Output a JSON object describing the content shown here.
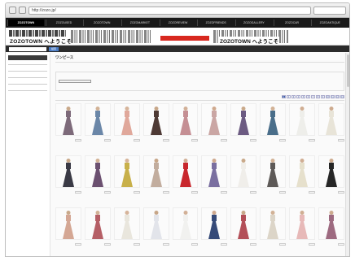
{
  "browser": {
    "address": "http://zozo.jp/",
    "search_placeholder": ""
  },
  "nav": {
    "tabs": [
      {
        "label": "ZOZOTOWN",
        "active": true
      },
      {
        "label": "ZOZOUSED",
        "active": false
      },
      {
        "label": "ZOZOTOWN",
        "active": false
      },
      {
        "label": "ZOZOMARKET",
        "active": false
      },
      {
        "label": "ZOZOREVIEW",
        "active": false
      },
      {
        "label": "ZOZOFRIENDS",
        "active": false
      },
      {
        "label": "ZOZOGALLERY",
        "active": false
      },
      {
        "label": "ZOZOCAR",
        "active": false
      },
      {
        "label": "ZOZOANTIQUE",
        "active": false
      }
    ]
  },
  "banner": {
    "logo_text": "ZOZOTOWN へようこそ",
    "logo_text2": "ZOZOTOWN へようこそ",
    "cta_label": "",
    "user_line1": "",
    "user_line2": "",
    "user_btn": ""
  },
  "searchbar": {
    "search_button": "検索",
    "link": ""
  },
  "sidebar": {
    "header": "",
    "groups": [
      {
        "title": "",
        "links": [
          "",
          "",
          ""
        ]
      },
      {
        "title": "",
        "links": [
          "",
          "",
          "",
          ""
        ]
      },
      {
        "title": "",
        "links": [
          "",
          "",
          "",
          "",
          "",
          "",
          ""
        ]
      },
      {
        "title": "",
        "links": [
          "",
          "",
          ""
        ]
      },
      {
        "title": "",
        "links": [
          "",
          "",
          "",
          ""
        ]
      }
    ]
  },
  "main": {
    "title": "ワンピース",
    "lines": [
      "",
      "",
      "",
      ""
    ],
    "tags": [
      "",
      ""
    ],
    "count_text": "",
    "pager": [
      "1",
      "2",
      "3",
      "4",
      "5",
      "6",
      "7",
      "8",
      "9",
      "10",
      "11",
      "12",
      "13"
    ]
  },
  "colors": {
    "accent": "#3a5ea8",
    "price": "#cc3333",
    "nav_bg": "#1a1a1a"
  },
  "products": [
    {
      "name": "",
      "price": "",
      "dress": "#7d6a7a",
      "skin": "#c9a98a"
    },
    {
      "name": "",
      "price": "",
      "dress": "#6b87a8",
      "skin": "#d2b296"
    },
    {
      "name": "",
      "price": "",
      "dress": "#e0a89b",
      "skin": "#d6b49a"
    },
    {
      "name": "",
      "price": "",
      "dress": "#4e3a35",
      "skin": "#c7a688"
    },
    {
      "name": "",
      "price": "",
      "dress": "#c58f94",
      "skin": "#d2b097"
    },
    {
      "name": "",
      "price": "",
      "dress": "#caa6a4",
      "skin": "#cfa98e"
    },
    {
      "name": "",
      "price": "",
      "dress": "#6c5b82",
      "skin": "#c9a98a"
    },
    {
      "name": "",
      "price": "",
      "dress": "#4a6e8a",
      "skin": "#d2b296"
    },
    {
      "name": "",
      "price": "",
      "dress": "#eeeeea",
      "skin": "#d0ae93"
    },
    {
      "name": "",
      "price": "",
      "dress": "#e8e4d8",
      "skin": "#cdab8f"
    },
    {
      "name": "",
      "price": "",
      "dress": "#3a3a45",
      "skin": "#c9a98a"
    },
    {
      "name": "",
      "price": "",
      "dress": "#6b5070",
      "skin": "#d2b296"
    },
    {
      "name": "",
      "price": "",
      "dress": "#c8b04a",
      "skin": "#d6b49a"
    },
    {
      "name": "",
      "price": "",
      "dress": "#c2ad9e",
      "skin": "#c7a688"
    },
    {
      "name": "",
      "price": "",
      "dress": "#c8272d",
      "skin": "#d2b097"
    },
    {
      "name": "",
      "price": "",
      "dress": "#7a6fa0",
      "skin": "#cfa98e"
    },
    {
      "name": "",
      "price": "",
      "dress": "#f0eeea",
      "skin": "#c9a98a"
    },
    {
      "name": "",
      "price": "",
      "dress": "#5e5a58",
      "skin": "#d2b296"
    },
    {
      "name": "",
      "price": "",
      "dress": "#e6e0cc",
      "skin": "#d0ae93"
    },
    {
      "name": "",
      "price": "",
      "dress": "#262626",
      "skin": "#cdab8f"
    },
    {
      "name": "",
      "price": "",
      "dress": "#d4a794",
      "skin": "#c9a98a"
    },
    {
      "name": "",
      "price": "",
      "dress": "#b55f66",
      "skin": "#d2b296"
    },
    {
      "name": "",
      "price": "",
      "dress": "#e9e6dd",
      "skin": "#d6b49a"
    },
    {
      "name": "",
      "price": "",
      "dress": "#e2e4ea",
      "skin": "#c7a688"
    },
    {
      "name": "",
      "price": "",
      "dress": "#f1f1ef",
      "skin": "#d2b097"
    },
    {
      "name": "",
      "price": "",
      "dress": "#354a78",
      "skin": "#cfa98e"
    },
    {
      "name": "",
      "price": "",
      "dress": "#b34f58",
      "skin": "#c9a98a"
    },
    {
      "name": "",
      "price": "",
      "dress": "#dcd5c8",
      "skin": "#d2b296"
    },
    {
      "name": "",
      "price": "",
      "dress": "#e7b9b8",
      "skin": "#d0ae93"
    },
    {
      "name": "",
      "price": "",
      "dress": "#9d6a80",
      "skin": "#cdab8f"
    }
  ]
}
